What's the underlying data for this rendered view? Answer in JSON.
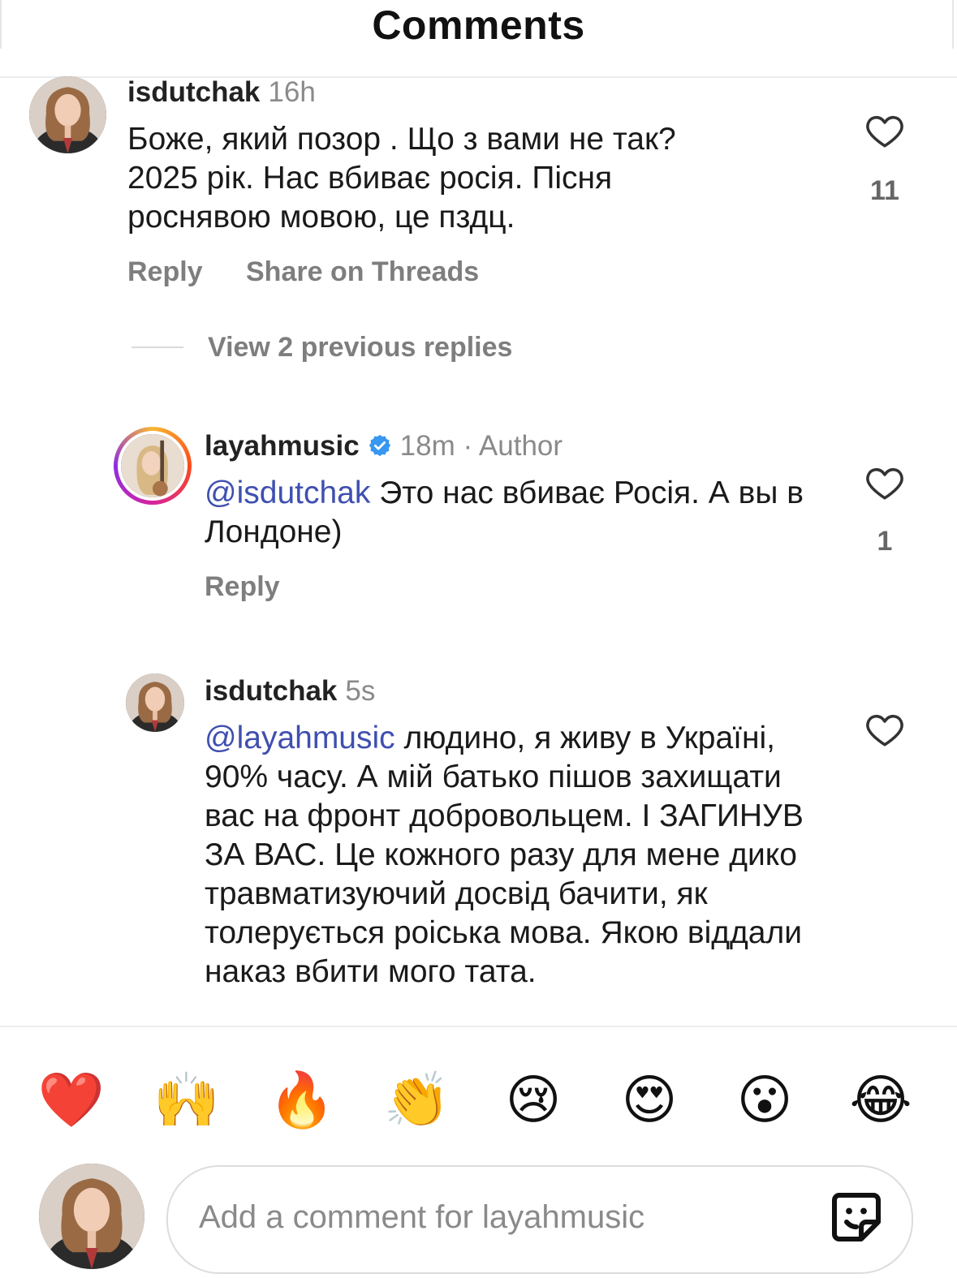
{
  "header": {
    "title": "Comments"
  },
  "comments": [
    {
      "username": "isdutchak",
      "time": "16h",
      "text": "Боже, який позор . Що з вами не так? 2025 рік. Нас вбиває росія. Пісня роснявою мовою, це пздц.",
      "likes": "11",
      "reply_label": "Reply",
      "share_label": "Share on Threads"
    },
    {
      "username": "layahmusic",
      "time": "18m",
      "author_tag": "· Author",
      "verified": true,
      "mention": "@isdutchak",
      "text": " Это нас вбиває Росія. А вы в Лондоне)",
      "likes": "1",
      "reply_label": "Reply"
    },
    {
      "username": "isdutchak",
      "time": "5s",
      "mention": "@layahmusic",
      "text": " людино, я живу в Україні, 90% часу. А мій батько пішов захищати вас на фронт добровольцем. І ЗАГИНУВ ЗА ВАС. Це кожного разу для мене дико травматизуючий досвід бачити, як толерується роіська мова. Якою віддали наказ вбити мого тата."
    }
  ],
  "view_replies_label": "View 2 previous replies",
  "reactions": [
    "❤️",
    "🙌",
    "🔥",
    "👏",
    "😢",
    "😍",
    "😮",
    "😂"
  ],
  "composer": {
    "placeholder": "Add a comment for layahmusic"
  },
  "colors": {
    "mention": "#3f4fb0",
    "verified": "#3897f0",
    "like": "#333333"
  },
  "icons": [
    "heart-outline-icon",
    "verified-badge-icon",
    "sticker-icon"
  ]
}
